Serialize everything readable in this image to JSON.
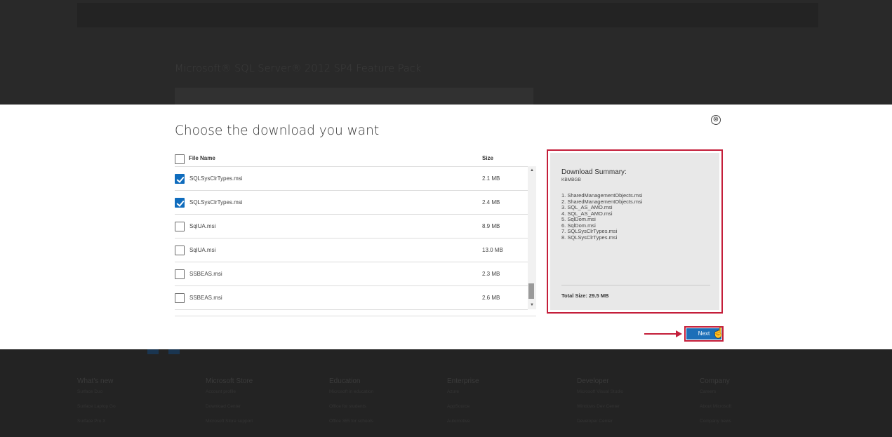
{
  "background": {
    "page_title": "Microsoft® SQL Server® 2012 SP4 Feature Pack",
    "footer": [
      {
        "heading": "What's new",
        "links": [
          "Surface Duo",
          "Surface Laptop Go",
          "Surface Pro X"
        ]
      },
      {
        "heading": "Microsoft Store",
        "links": [
          "Account profile",
          "Download Center",
          "Microsoft Store support"
        ]
      },
      {
        "heading": "Education",
        "links": [
          "Microsoft in education",
          "Office for students",
          "Office 365 for schools"
        ]
      },
      {
        "heading": "Enterprise",
        "links": [
          "Azure",
          "AppSource",
          "Automotive"
        ]
      },
      {
        "heading": "Developer",
        "links": [
          "Microsoft Visual Studio",
          "Windows Dev Center",
          "Developer Center"
        ]
      },
      {
        "heading": "Company",
        "links": [
          "Careers",
          "About Microsoft",
          "Company news"
        ]
      }
    ]
  },
  "modal": {
    "title": "Choose the download you want",
    "close_icon": "⊗",
    "table": {
      "col_name": "File Name",
      "col_size": "Size",
      "rows": [
        {
          "name": "SQLSysClrTypes.msi",
          "size": "2.1 MB",
          "checked": true
        },
        {
          "name": "SQLSysClrTypes.msi",
          "size": "2.4 MB",
          "checked": true
        },
        {
          "name": "SqlUA.msi",
          "size": "8.9 MB",
          "checked": false
        },
        {
          "name": "SqlUA.msi",
          "size": "13.0 MB",
          "checked": false
        },
        {
          "name": "SSBEAS.msi",
          "size": "2.3 MB",
          "checked": false
        },
        {
          "name": "SSBEAS.msi",
          "size": "2.6 MB",
          "checked": false
        }
      ]
    },
    "summary": {
      "title": "Download Summary:",
      "subtitle": "KBMBGB",
      "items": [
        "1. SharedManagementObjects.msi",
        "2. SharedManagementObjects.msi",
        "3. SQL_AS_AMO.msi",
        "4. SQL_AS_AMO.msi",
        "5. SqlDom.msi",
        "6. SqlDom.msi",
        "7. SQLSysClrTypes.msi",
        "8. SQLSysClrTypes.msi"
      ],
      "total": "Total Size: 29.5 MB"
    },
    "next_label": "Next",
    "scroll_up_icon": "▲",
    "scroll_down_icon": "▼"
  },
  "colors": {
    "accent_blue": "#1c6fb8",
    "annotation_red": "#c41e3a"
  },
  "icons": {
    "close": "close-circle-icon",
    "cursor": "hand-pointer-icon",
    "arrow": "right-arrow-annotation"
  }
}
